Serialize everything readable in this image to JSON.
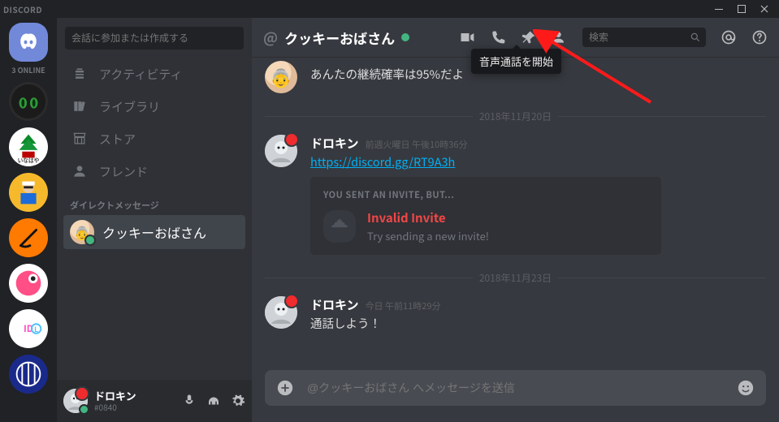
{
  "app": {
    "brand": "DISCORD"
  },
  "servers": {
    "online_label": "3 ONLINE"
  },
  "sidebar": {
    "search_placeholder": "会話に参加または作成する",
    "nav": [
      {
        "label": "アクティビティ"
      },
      {
        "label": "ライブラリ"
      },
      {
        "label": "ストア"
      },
      {
        "label": "フレンド"
      }
    ],
    "dm_header": "ダイレクトメッセージ",
    "dms": [
      {
        "name": "クッキーおばさん"
      }
    ]
  },
  "user_panel": {
    "name": "ドロキン",
    "tag": "#0840"
  },
  "header": {
    "at": "@",
    "channel": "クッキーおばさん",
    "search_placeholder": "検索",
    "tooltip": "音声通話を開始"
  },
  "chat": {
    "msg0": {
      "text": "あんたの継続確率は95%だよ"
    },
    "sep1": "2018年11月20日",
    "msg1": {
      "user": "ドロキン",
      "time": "前週火曜日 午後10時36分",
      "link": "https://discord.gg/RT9A3h"
    },
    "invite": {
      "title": "YOU SENT AN INVITE, BUT...",
      "name": "Invalid Invite",
      "sub": "Try sending a new invite!"
    },
    "sep2": "2018年11月23日",
    "msg2": {
      "user": "ドロキン",
      "time": "今日 午前11時29分",
      "text": "通話しよう！"
    }
  },
  "compose": {
    "placeholder": "@クッキーおばさん へメッセージを送信"
  }
}
